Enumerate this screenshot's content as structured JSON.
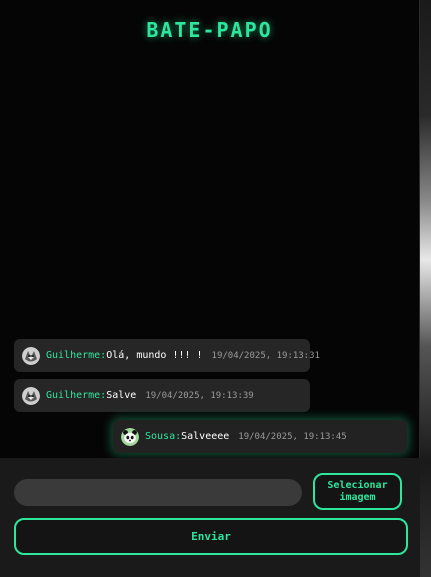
{
  "header": {
    "title": "BATE-PAPO"
  },
  "messages": [
    {
      "sender": "Guilherme:",
      "text": "Olá, mundo !!! !",
      "time": "19/04/2025, 19:13:31",
      "avatar": "wolf-avatar-icon",
      "own": false
    },
    {
      "sender": "Guilherme:",
      "text": "Salve",
      "time": "19/04/2025, 19:13:39",
      "avatar": "wolf-avatar-icon",
      "own": false
    },
    {
      "sender": "Sousa:",
      "text": "Salveeee",
      "time": "19/04/2025, 19:13:45",
      "avatar": "panda-avatar-icon",
      "own": true
    }
  ],
  "composer": {
    "input_value": "",
    "input_placeholder": "",
    "select_image_label": "Selecionar\nimagem",
    "send_label": "Enviar"
  },
  "colors": {
    "accent": "#2ee59d",
    "background": "#050505",
    "bubble": "#262626",
    "composer_bg": "#1a1a1a",
    "input_bg": "#3a3a3a"
  }
}
